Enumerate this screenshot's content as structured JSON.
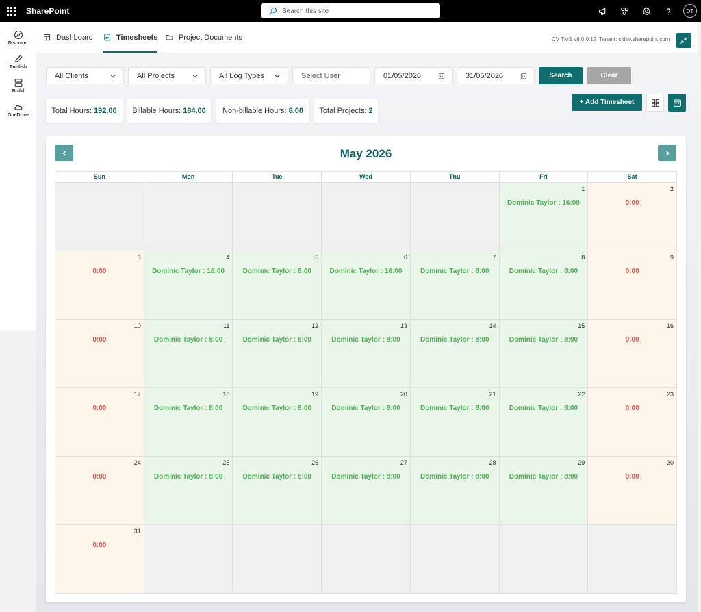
{
  "suite": {
    "brand": "SharePoint",
    "search_placeholder": "Search this site",
    "avatar_initials": "DT"
  },
  "rail": [
    {
      "label": "Discover",
      "icon": "compass-icon"
    },
    {
      "label": "Publish",
      "icon": "pen-icon"
    },
    {
      "label": "Build",
      "icon": "layout-icon"
    },
    {
      "label": "OneDrive",
      "icon": "cloud-icon"
    }
  ],
  "tabs": {
    "dashboard": "Dashboard",
    "timesheets": "Timesheets",
    "documents": "Project Documents"
  },
  "header": {
    "version": "CV TMS v8.0.0.12",
    "tenant": "Tenant: cidev.sharepoint.com"
  },
  "filters": {
    "clients": "All Clients",
    "projects": "All Projects",
    "log_types": "All Log Types",
    "user_placeholder": "Select User",
    "from_date": "01/05/2026",
    "to_date": "31/05/2026",
    "search": "Search",
    "clear": "Clear"
  },
  "stats": {
    "total_label": "Total Hours:",
    "total_value": "192.00",
    "billable_label": "Billable Hours:",
    "billable_value": "184.00",
    "nonbillable_label": "Non-billable Hours:",
    "nonbillable_value": "8.00",
    "projects_label": "Total Projects:",
    "projects_value": "2"
  },
  "actions": {
    "add_timesheet": "+ Add Timesheet"
  },
  "calendar": {
    "title": "May 2026",
    "days": [
      "Sun",
      "Mon",
      "Tue",
      "Wed",
      "Thu",
      "Fri",
      "Sat"
    ],
    "weeks": [
      [
        {
          "day": "",
          "text": "",
          "type": "empty"
        },
        {
          "day": "",
          "text": "",
          "type": "empty"
        },
        {
          "day": "",
          "text": "",
          "type": "empty"
        },
        {
          "day": "",
          "text": "",
          "type": "empty"
        },
        {
          "day": "",
          "text": "",
          "type": "empty"
        },
        {
          "day": "1",
          "text": "Dominic Taylor : 16:00",
          "type": "work"
        },
        {
          "day": "2",
          "text": "0:00",
          "type": "off"
        }
      ],
      [
        {
          "day": "3",
          "text": "0:00",
          "type": "off"
        },
        {
          "day": "4",
          "text": "Dominic Taylor : 16:00",
          "type": "work"
        },
        {
          "day": "5",
          "text": "Dominic Taylor : 8:00",
          "type": "work"
        },
        {
          "day": "6",
          "text": "Dominic Taylor : 16:00",
          "type": "work"
        },
        {
          "day": "7",
          "text": "Dominic Taylor : 8:00",
          "type": "work"
        },
        {
          "day": "8",
          "text": "Dominic Taylor : 8:00",
          "type": "work"
        },
        {
          "day": "9",
          "text": "0:00",
          "type": "off"
        }
      ],
      [
        {
          "day": "10",
          "text": "0:00",
          "type": "off"
        },
        {
          "day": "11",
          "text": "Dominic Taylor : 8:00",
          "type": "work"
        },
        {
          "day": "12",
          "text": "Dominic Taylor : 8:00",
          "type": "work"
        },
        {
          "day": "13",
          "text": "Dominic Taylor : 8:00",
          "type": "work"
        },
        {
          "day": "14",
          "text": "Dominic Taylor : 8:00",
          "type": "work"
        },
        {
          "day": "15",
          "text": "Dominic Taylor : 8:00",
          "type": "work"
        },
        {
          "day": "16",
          "text": "0:00",
          "type": "off"
        }
      ],
      [
        {
          "day": "17",
          "text": "0:00",
          "type": "off"
        },
        {
          "day": "18",
          "text": "Dominic Taylor : 8:00",
          "type": "work"
        },
        {
          "day": "19",
          "text": "Dominic Taylor : 8:00",
          "type": "work"
        },
        {
          "day": "20",
          "text": "Dominic Taylor : 8:00",
          "type": "work"
        },
        {
          "day": "21",
          "text": "Dominic Taylor : 8:00",
          "type": "work"
        },
        {
          "day": "22",
          "text": "Dominic Taylor : 8:00",
          "type": "work"
        },
        {
          "day": "23",
          "text": "0:00",
          "type": "off"
        }
      ],
      [
        {
          "day": "24",
          "text": "0:00",
          "type": "off"
        },
        {
          "day": "25",
          "text": "Dominic Taylor : 8:00",
          "type": "work"
        },
        {
          "day": "26",
          "text": "Dominic Taylor : 8:00",
          "type": "work"
        },
        {
          "day": "27",
          "text": "Dominic Taylor : 8:00",
          "type": "work"
        },
        {
          "day": "28",
          "text": "Dominic Taylor : 8:00",
          "type": "work"
        },
        {
          "day": "29",
          "text": "Dominic Taylor : 8:00",
          "type": "work"
        },
        {
          "day": "30",
          "text": "0:00",
          "type": "off"
        }
      ],
      [
        {
          "day": "31",
          "text": "0:00",
          "type": "off"
        },
        {
          "day": "",
          "text": "",
          "type": "empty"
        },
        {
          "day": "",
          "text": "",
          "type": "empty"
        },
        {
          "day": "",
          "text": "",
          "type": "empty"
        },
        {
          "day": "",
          "text": "",
          "type": "empty"
        },
        {
          "day": "",
          "text": "",
          "type": "empty"
        },
        {
          "day": "",
          "text": "",
          "type": "empty"
        }
      ]
    ]
  },
  "colors": {
    "accent": "#0f6d6d",
    "work_bg": "#eaf6ea",
    "work_text": "#4caf50",
    "off_bg": "#fff6ea",
    "off_text": "#d9534f",
    "empty_bg": "#f0f0f0"
  }
}
